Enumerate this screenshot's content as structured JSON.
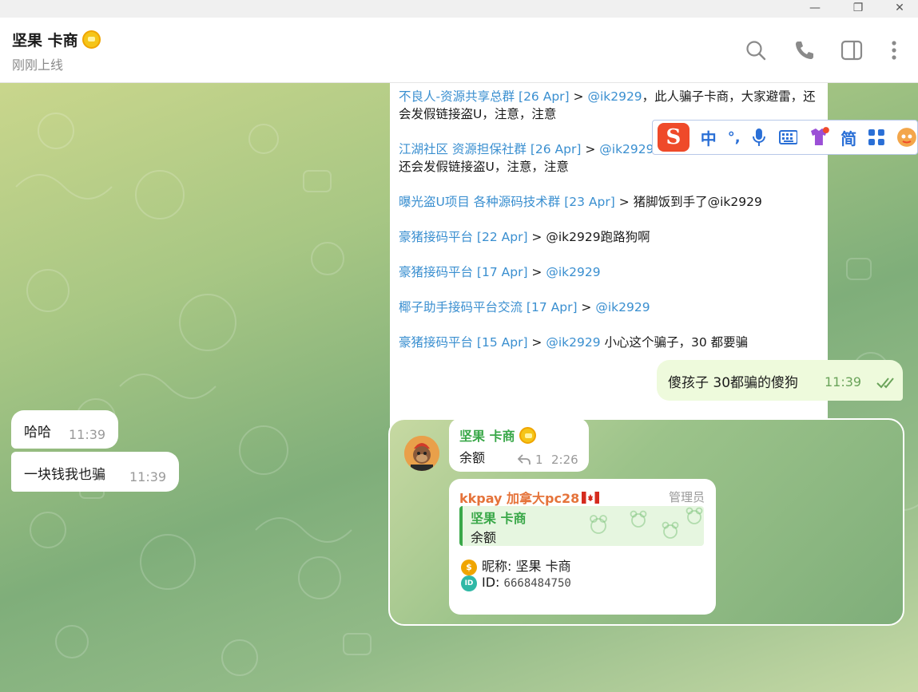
{
  "window": {
    "minimize": "—",
    "restore": "❐",
    "close": "✕"
  },
  "header": {
    "title": "坚果 卡商",
    "status": "刚刚上线"
  },
  "forwarded_list": [
    {
      "group": "不良人-资源共享总群 [26 Apr]",
      "sep": " > ",
      "mention": "@ik2929",
      "text": "，此人骗子卡商，大家避雷，还会发假链接盗U，注意，注意"
    },
    {
      "group": "江湖社区 资源担保社群 [26 Apr]",
      "sep": " > ",
      "mention": "@ik2929",
      "text": "，此人骗子卡商，大家避雷，还会发假链接盗U，注意，注意"
    },
    {
      "group": "曝光盗U项目 各种源码技术群 [23 Apr]",
      "sep": " > ",
      "mention": "",
      "text": "猪脚饭到手了@ik2929"
    },
    {
      "group": "豪猪接码平台 [22 Apr]",
      "sep": " > ",
      "mention": "",
      "text": "@ik2929跑路狗啊"
    },
    {
      "group": "豪猪接码平台 [17 Apr]",
      "sep": " > ",
      "mention": "@ik2929",
      "text": ""
    },
    {
      "group": "椰子助手接码平台交流 [17 Apr]",
      "sep": " > ",
      "mention": "@ik2929",
      "text": ""
    },
    {
      "group": "豪猪接码平台 [15 Apr]",
      "sep": " > ",
      "mention": "@ik2929",
      "text": " 小心这个骗子，30 都要骗"
    }
  ],
  "ime": {
    "logo": "S",
    "lang": "中",
    "punct": "°,",
    "simplified": "简"
  },
  "messages": {
    "out1": {
      "text": "傻孩子 30都骗的傻狗",
      "time": "11:39"
    },
    "in1": {
      "text": "哈哈",
      "time": "11:39"
    },
    "in2": {
      "text": "一块钱我也骗",
      "time": "11:39"
    }
  },
  "reply_msg": {
    "sender": "坚果 卡商",
    "text": "余额",
    "reply_count": "1",
    "time": "2:26"
  },
  "bot_msg": {
    "sender": "kkpay 加拿大pc28",
    "role": "管理员",
    "quote_sender": "坚果 卡商",
    "quote_text": "余额",
    "nickname_label": "昵称: 坚果 卡商",
    "id_label": "ID:",
    "id_value": "6668484750"
  },
  "colors": {
    "link": "#3a8fd0",
    "sender_green": "#3aa849",
    "bot_orange": "#e5733a",
    "out_bubble": "#eefadc"
  }
}
